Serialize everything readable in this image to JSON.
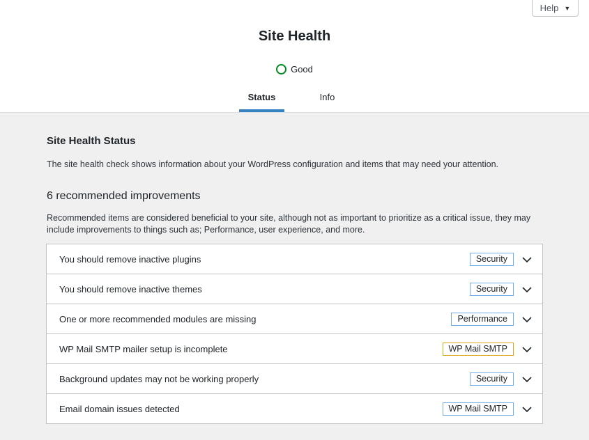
{
  "header": {
    "help_label": "Help",
    "title": "Site Health",
    "status_label": "Good",
    "status_color": "#008a20",
    "tabs": [
      {
        "label": "Status",
        "active": true
      },
      {
        "label": "Info",
        "active": false
      }
    ],
    "accent_color": "#3582c4"
  },
  "main": {
    "section_title": "Site Health Status",
    "intro": "The site health check shows information about your WordPress configuration and items that may need your attention.",
    "count_title": "6 recommended improvements",
    "description": "Recommended items are considered beneficial to your site, although not as important to prioritize as a critical issue, they may include improvements to things such as; Performance, user experience, and more.",
    "items": [
      {
        "label": "You should remove inactive plugins",
        "badge": "Security",
        "badge_color": "#72aee6"
      },
      {
        "label": "You should remove inactive themes",
        "badge": "Security",
        "badge_color": "#72aee6"
      },
      {
        "label": "One or more recommended modules are missing",
        "badge": "Performance",
        "badge_color": "#72aee6"
      },
      {
        "label": "WP Mail SMTP mailer setup is incomplete",
        "badge": "WP Mail SMTP",
        "badge_color": "#dba617"
      },
      {
        "label": "Background updates may not be working properly",
        "badge": "Security",
        "badge_color": "#72aee6"
      },
      {
        "label": "Email domain issues detected",
        "badge": "WP Mail SMTP",
        "badge_color": "#72aee6"
      }
    ]
  }
}
